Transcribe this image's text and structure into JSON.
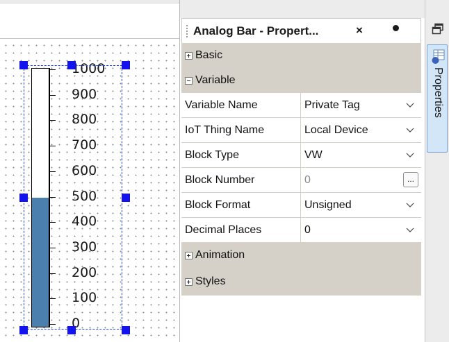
{
  "canvas": {
    "analog_bar": {
      "scale_labels": [
        "1000",
        "900",
        "800",
        "700",
        "600",
        "500",
        "400",
        "300",
        "200",
        "100",
        "0"
      ],
      "min": 0,
      "max": 1000,
      "fill_value": 500,
      "fill_color": "#4a7fae",
      "selection_color": "#1313ee"
    }
  },
  "panel": {
    "title": "Analog Bar - Propert...",
    "close_glyph": "×",
    "groups": {
      "basic": "Basic",
      "variable": "Variable",
      "animation": "Animation",
      "styles": "Styles"
    },
    "properties": [
      {
        "name": "Variable Name",
        "value": "Private Tag",
        "control": "dropdown"
      },
      {
        "name": "IoT Thing Name",
        "value": "Local Device",
        "control": "dropdown"
      },
      {
        "name": "Block Type",
        "value": "VW",
        "control": "dropdown"
      },
      {
        "name": "Block Number",
        "value": "0",
        "control": "ellipsis"
      },
      {
        "name": "Block Format",
        "value": "Unsigned",
        "control": "dropdown"
      },
      {
        "name": "Decimal Places",
        "value": "0",
        "control": "dropdown"
      }
    ],
    "ellipsis_label": "..."
  },
  "sidebar": {
    "tab_label": "Properties",
    "icons": [
      "restore-window-icon",
      "properties-grid-icon"
    ]
  },
  "colors": {
    "grid_group_bg": "#d5d0c8",
    "tab_active_bg": "#d3e6f7",
    "tab_active_border": "#7aa7d6"
  }
}
